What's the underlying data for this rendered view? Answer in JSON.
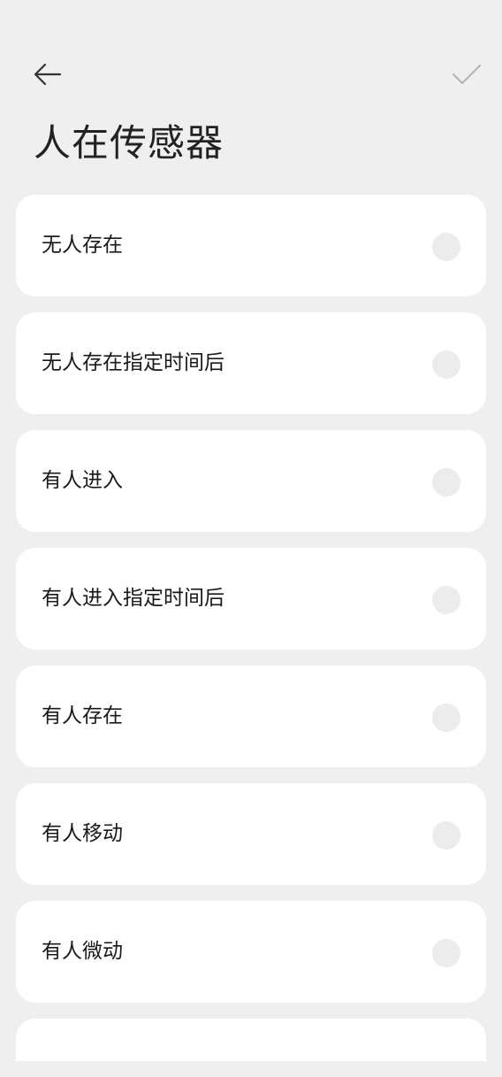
{
  "header": {
    "title": "人在传感器",
    "back_icon": "arrow-left-icon",
    "confirm_icon": "checkmark-icon"
  },
  "options": [
    {
      "label": "无人存在",
      "selected": false
    },
    {
      "label": "无人存在指定时间后",
      "selected": false
    },
    {
      "label": "有人进入",
      "selected": false
    },
    {
      "label": "有人进入指定时间后",
      "selected": false
    },
    {
      "label": "有人存在",
      "selected": false
    },
    {
      "label": "有人移动",
      "selected": false
    },
    {
      "label": "有人微动",
      "selected": false
    }
  ],
  "colors": {
    "background": "#efefef",
    "card": "#ffffff",
    "radio_unselected": "#ececec",
    "text": "#1a1a1a",
    "icon": "#333333",
    "confirm_icon_disabled": "#b5b5b5"
  }
}
